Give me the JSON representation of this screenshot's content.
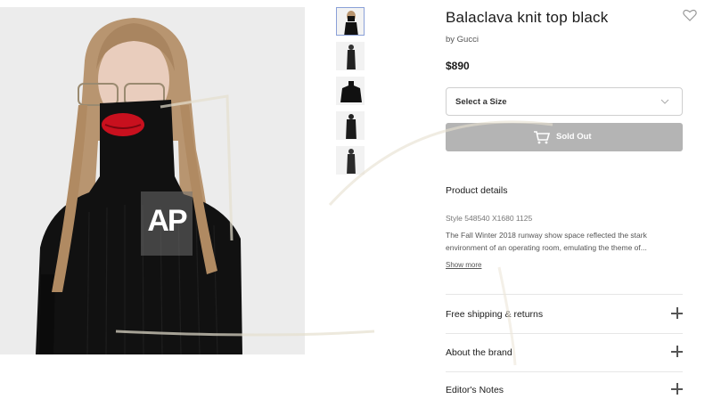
{
  "product": {
    "title": "Balaclava knit top black",
    "byline": "by Gucci",
    "price": "$890"
  },
  "size_select": {
    "label": "Select a Size"
  },
  "buy_button": {
    "label": "Sold Out"
  },
  "watermark": {
    "text": "AP"
  },
  "details": {
    "heading": "Product details",
    "style_number": "Style 548540 X1680 1125",
    "description": "The Fall Winter 2018 runway show space reflected the stark environment of an operating room, emulating the theme of...",
    "show_more": "Show more"
  },
  "accordion": [
    {
      "label": "Free shipping & returns"
    },
    {
      "label": "About the brand"
    },
    {
      "label": "Editor's Notes"
    }
  ],
  "colors": {
    "sold_out_bg": "#b4b4b4",
    "hero_bg": "#ececec",
    "garment": "#111111",
    "lips": "#c8101e",
    "hair": "#b89570"
  },
  "icons": [
    "heart-icon",
    "chevron-down-icon",
    "cart-icon",
    "plus-icon"
  ]
}
